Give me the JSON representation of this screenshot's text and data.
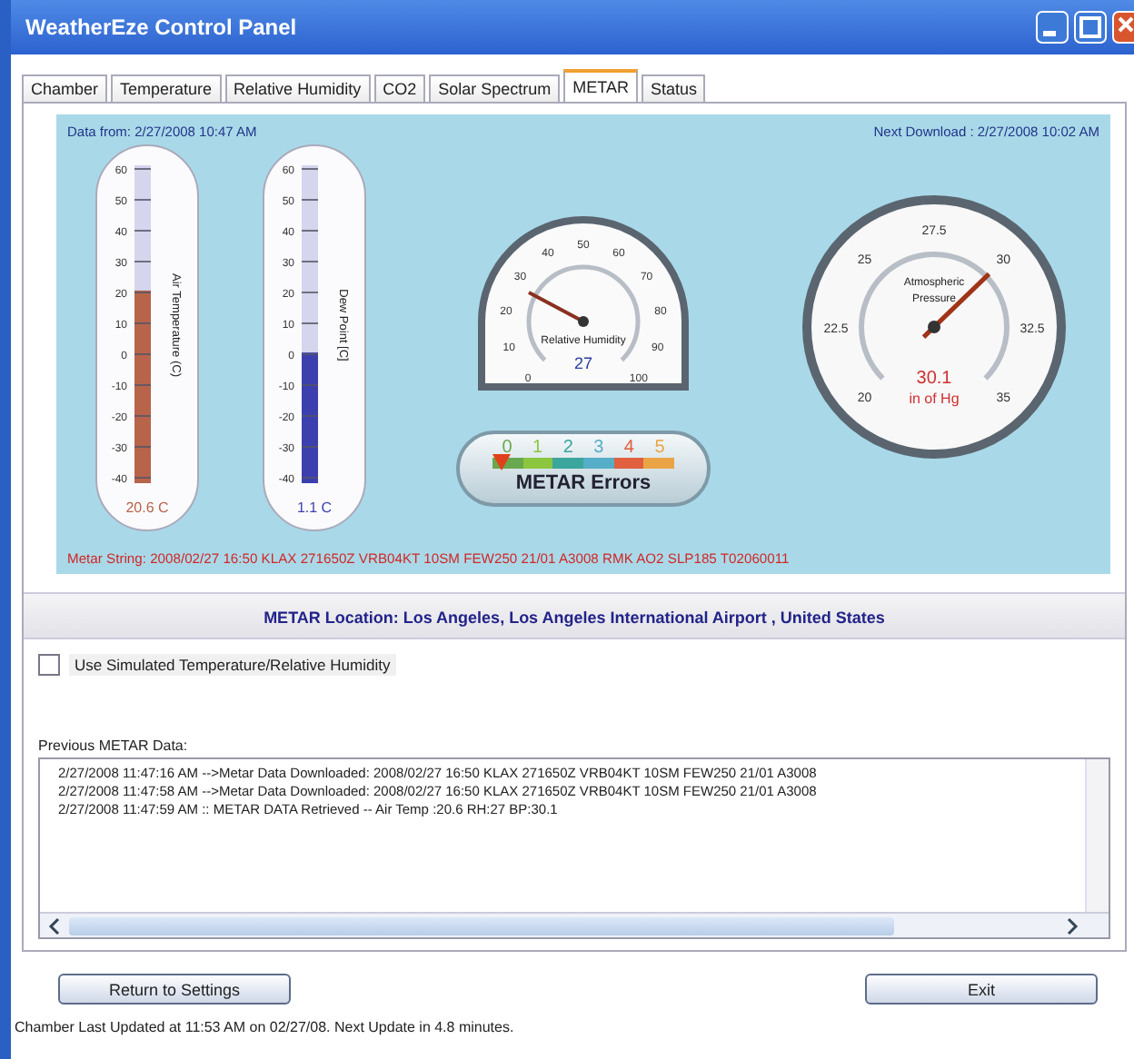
{
  "window": {
    "title": "WeatherEze Control Panel"
  },
  "tabs": [
    {
      "label": "Chamber",
      "selected": false
    },
    {
      "label": "Temperature",
      "selected": false
    },
    {
      "label": "Relative Humidity",
      "selected": false
    },
    {
      "label": "CO2",
      "selected": false
    },
    {
      "label": "Solar Spectrum",
      "selected": false
    },
    {
      "label": "METAR",
      "selected": true
    },
    {
      "label": "Status",
      "selected": false
    }
  ],
  "panel": {
    "data_from": "Data from: 2/27/2008 10:47 AM",
    "next_download": "Next Download : 2/27/2008 10:02 AM",
    "thermometers": [
      {
        "label": "Air Temperature (C)",
        "reading": "20.6 C",
        "level": 0.606,
        "color": "#b8644a",
        "ticks": [
          "60",
          "50",
          "40",
          "30",
          "20",
          "10",
          "0",
          "-10",
          "-20",
          "-30",
          "-40"
        ]
      },
      {
        "label": "Dew Point [C]",
        "reading": "1.1 C",
        "level": 0.411,
        "color": "#3c3fae",
        "ticks": [
          "60",
          "50",
          "40",
          "30",
          "20",
          "10",
          "0",
          "-10",
          "-20",
          "-30",
          "-40"
        ]
      }
    ],
    "humidity_gauge": {
      "label": "Relative Humidity",
      "reading": "27",
      "ticks": [
        "0",
        "10",
        "20",
        "30",
        "40",
        "50",
        "60",
        "70",
        "80",
        "90",
        "100"
      ]
    },
    "pressure_gauge": {
      "label_lines": [
        "Atmospheric",
        "Pressure"
      ],
      "reading": "30.1",
      "unit": "in of Hg",
      "ticks": [
        "20",
        "22.5",
        "25",
        "27.5",
        "30",
        "32.5",
        "35"
      ]
    },
    "errors": {
      "label": "METAR Errors",
      "scale": [
        {
          "label": "0",
          "color": "#6aa84f"
        },
        {
          "label": "1",
          "color": "#8cc63f"
        },
        {
          "label": "2",
          "color": "#3aa69c"
        },
        {
          "label": "3",
          "color": "#56aec8"
        },
        {
          "label": "4",
          "color": "#e06040"
        },
        {
          "label": "5",
          "color": "#e9a545"
        }
      ]
    },
    "metar_string": "Metar String: 2008/02/27 16:50 KLAX 271650Z VRB04KT 10SM FEW250 21/01 A3008 RMK AO2 SLP185 T02060011"
  },
  "location": "METAR Location: Los Angeles, Los Angeles International Airport , United States",
  "simulate": {
    "label": "Use Simulated Temperature/Relative Humidity",
    "checked": false
  },
  "log": {
    "label": "Previous METAR Data:",
    "lines": [
      "2/27/2008 11:47:16 AM -->Metar Data Downloaded: 2008/02/27 16:50 KLAX 271650Z VRB04KT 10SM FEW250 21/01 A3008",
      "2/27/2008 11:47:58 AM -->Metar Data Downloaded: 2008/02/27 16:50 KLAX 271650Z VRB04KT 10SM FEW250 21/01 A3008",
      "2/27/2008 11:47:59 AM :: METAR DATA Retrieved -- Air Temp :20.6   RH:27    BP:30.1"
    ]
  },
  "buttons": [
    {
      "label": "Return to Settings"
    },
    {
      "label": "Exit"
    }
  ],
  "status": "Chamber Last Updated at 11:53 AM on 02/27/08. Next Update in 4.8 minutes."
}
